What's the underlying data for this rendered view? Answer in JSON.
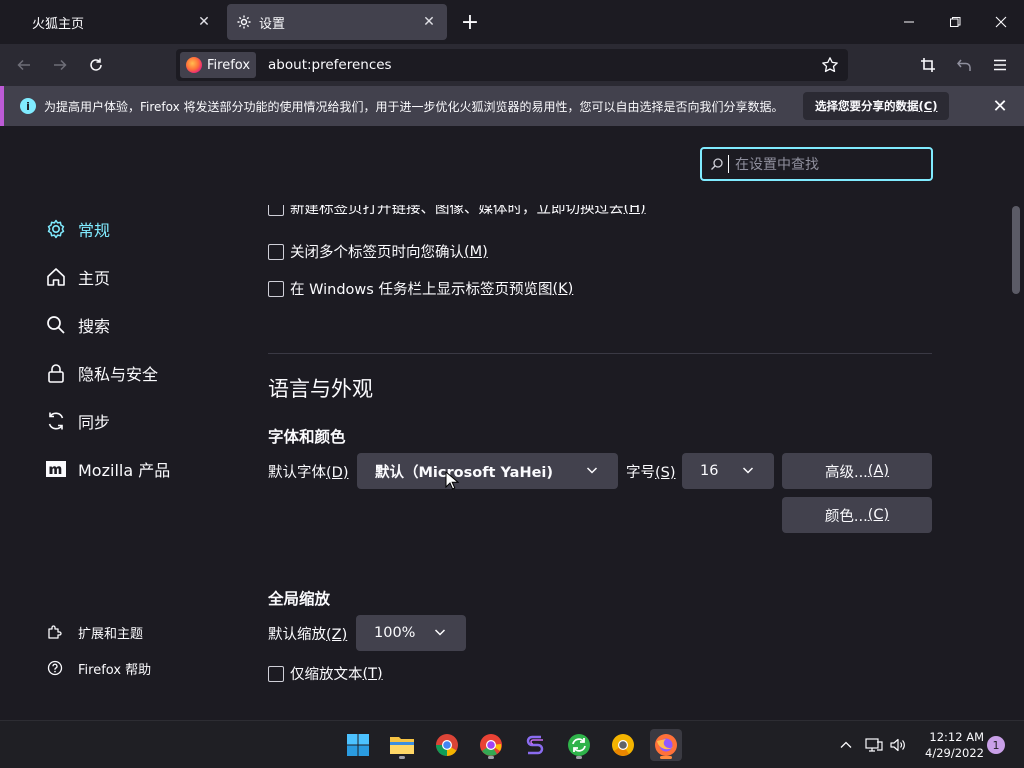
{
  "tabs": [
    {
      "title": "火狐主页"
    },
    {
      "title": "设置"
    }
  ],
  "identity": {
    "label": "Firefox"
  },
  "url": "about:preferences",
  "notification": {
    "message": "为提高用户体验，Firefox 将发送部分功能的使用情况给我们，用于进一步优化火狐浏览器的易用性，您可以自由选择是否向我们分享数据。",
    "button_label": "选择您要分享的数据",
    "button_key": "(C)"
  },
  "search": {
    "placeholder": "在设置中查找"
  },
  "sidebar": {
    "items": [
      {
        "label": "常规",
        "icon": "gear-icon"
      },
      {
        "label": "主页",
        "icon": "home-icon"
      },
      {
        "label": "搜索",
        "icon": "search-icon"
      },
      {
        "label": "隐私与安全",
        "icon": "lock-icon"
      },
      {
        "label": "同步",
        "icon": "sync-icon"
      },
      {
        "label": "Mozilla 产品",
        "icon": "mozilla-icon"
      }
    ],
    "footer": [
      {
        "label": "扩展和主题",
        "icon": "puzzle-icon"
      },
      {
        "label": "Firefox 帮助",
        "icon": "help-icon"
      }
    ]
  },
  "tabs_section": {
    "checkbox_partial": "新建标签页打开链接、图像、媒体时，立即切换过去",
    "checkbox_partial_key": "(H)",
    "checkbox_confirm": "关闭多个标签页时向您确认",
    "checkbox_confirm_key": "(M)",
    "checkbox_preview": "在 Windows 任务栏上显示标签页预览图",
    "checkbox_preview_key": "(K)"
  },
  "language": {
    "heading": "语言与外观",
    "fonts_heading": "字体和颜色",
    "default_font_label": "默认字体",
    "default_font_key": "(D)",
    "default_font_value": "默认（Microsoft YaHei)",
    "size_label": "字号",
    "size_key": "(S)",
    "size_value": "16",
    "advanced_button": "高级...",
    "advanced_key": "(A)",
    "colors_button": "颜色...",
    "colors_key": "(C)"
  },
  "zoom": {
    "heading": "全局缩放",
    "default_zoom_label": "默认缩放",
    "default_zoom_key": "(Z)",
    "default_zoom_value": "100%",
    "text_only_label": "仅缩放文本",
    "text_only_key": "(T)"
  },
  "taskbar": {
    "time": "12:12 AM",
    "date": "4/29/2022",
    "notification_count": "1"
  },
  "colors": {
    "accent": "#80ebff",
    "notify_border": "#bd5bd6",
    "surface": "#1c1b22",
    "control": "#42414d"
  }
}
